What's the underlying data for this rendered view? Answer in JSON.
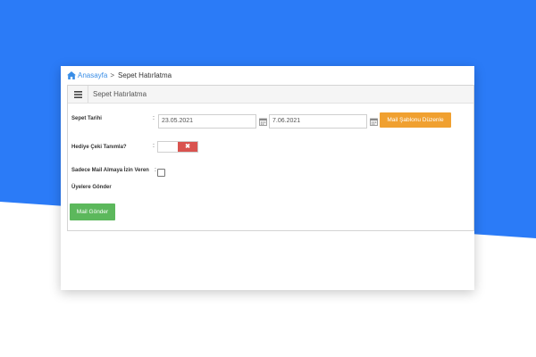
{
  "breadcrumb": {
    "home": "Anasayfa",
    "separator": ">",
    "current": "Sepet Hatırlatma"
  },
  "panel": {
    "title": "Sepet Hatırlatma"
  },
  "form": {
    "basket_date": {
      "label": "Sepet Tarihi",
      "colon": ":",
      "start": "23.05.2021",
      "end": "7.06.2021"
    },
    "template_button": "Mail Şablonu Düzenle",
    "gift": {
      "label": "Hediye Çeki Tanımla?",
      "colon": ":",
      "toggle_off": "✖"
    },
    "mail_permission": {
      "label_line1": "Sadece Mail Almaya İzin Veren",
      "colon": ":",
      "label_line2": "Üyelere Gönder"
    },
    "send_button": "Mail Gönder"
  },
  "colors": {
    "background_blue": "#2b7bf7",
    "home_link": "#3a8ee6",
    "orange_button": "#f0a030",
    "green_button": "#5cb85c",
    "toggle_red": "#d9534f"
  },
  "icons": {
    "home": "home-icon",
    "menu": "hamburger-icon",
    "calendar": "calendar-icon",
    "toggle": "close-icon"
  }
}
